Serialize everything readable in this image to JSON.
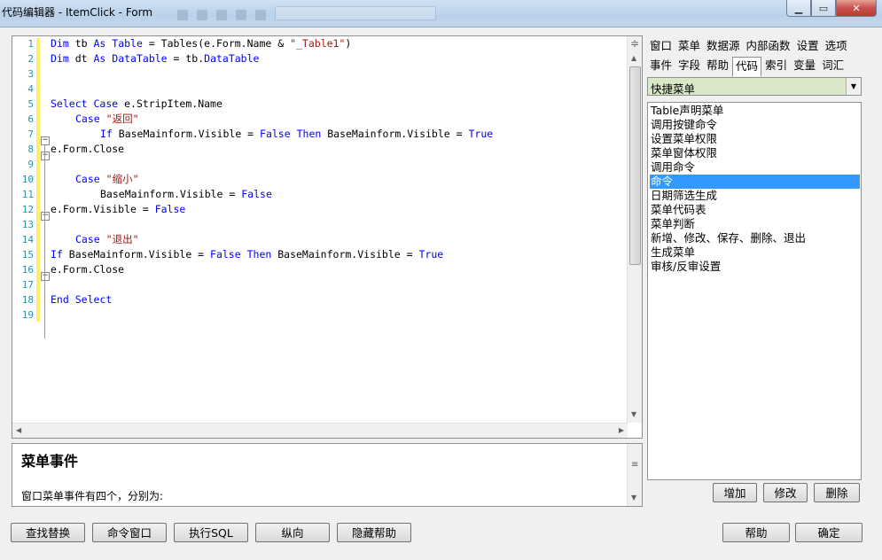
{
  "window": {
    "title": "代码编辑器 - ItemClick - Form"
  },
  "editor": {
    "line_numbers": [
      "1",
      "2",
      "3",
      "4",
      "5",
      "6",
      "7",
      "8",
      "9",
      "10",
      "11",
      "12",
      "13",
      "14",
      "15",
      "16",
      "17",
      "18",
      "19"
    ]
  },
  "help": {
    "heading": "菜单事件",
    "text": "窗口菜单事件有四个，分别为:"
  },
  "tabs": {
    "row1": [
      "窗口",
      "菜单",
      "数据源",
      "内部函数",
      "设置",
      "选项"
    ],
    "row2": [
      "事件",
      "字段",
      "帮助",
      "代码",
      "索引",
      "变量",
      "词汇"
    ],
    "active": "代码"
  },
  "category_dropdown": {
    "value": "快捷菜单"
  },
  "snippets": {
    "items": [
      "Table声明菜单",
      "调用按键命令",
      "设置菜单权限",
      "菜单窗体权限",
      "调用命令",
      "命令",
      "日期筛选生成",
      "菜单代码表",
      "菜单判断",
      "新增、修改、保存、删除、退出",
      "生成菜单",
      "审核/反审设置"
    ],
    "selected": "命令"
  },
  "snippet_buttons": {
    "add": "增加",
    "edit": "修改",
    "delete": "删除"
  },
  "bottom_buttons": {
    "find_replace": "查找替换",
    "command_window": "命令窗口",
    "exec_sql": "执行SQL",
    "vertical": "纵向",
    "hide_help": "隐藏帮助",
    "help": "帮助",
    "ok": "确定"
  },
  "colors": {
    "keyword": "#0000ff",
    "string": "#a31515",
    "line_number": "#2b91af",
    "selection": "#3399ff",
    "dropdown_bg": "#d8e8c8",
    "change_marker": "#ffee66"
  }
}
